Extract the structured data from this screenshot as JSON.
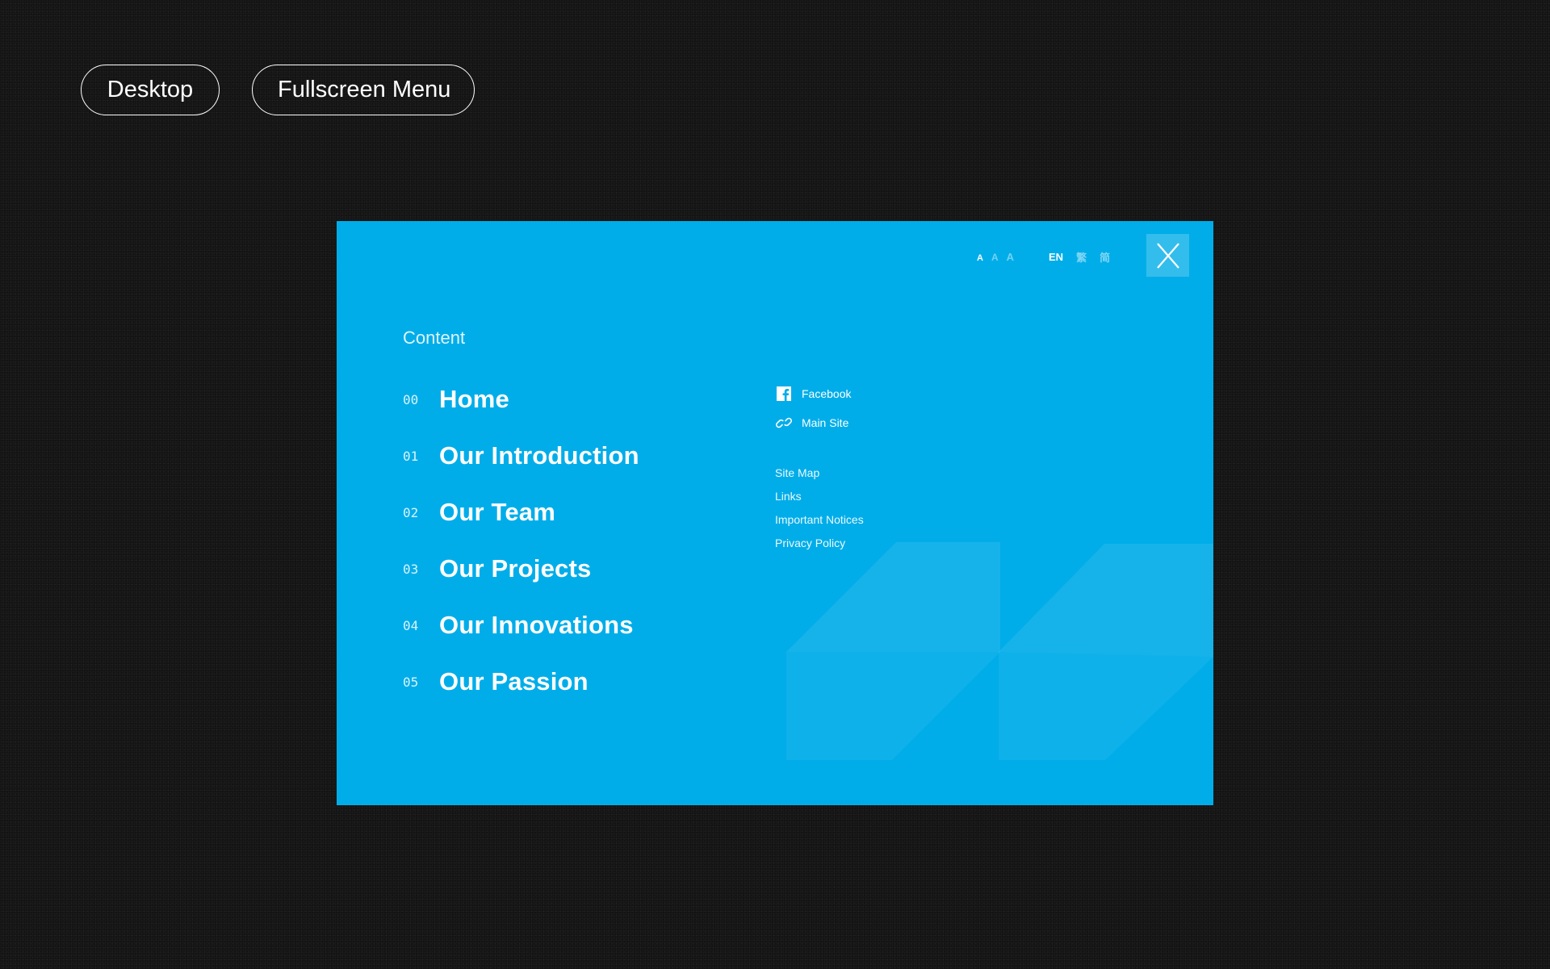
{
  "header": {
    "tags": [
      {
        "label": "Desktop"
      },
      {
        "label": "Fullscreen Menu"
      }
    ]
  },
  "menu_panel": {
    "background_color": "#00ade9",
    "font_sizes": [
      "A",
      "A",
      "A"
    ],
    "languages": [
      "EN",
      "繁",
      "简"
    ],
    "active_language": "EN",
    "close_icon": "close-icon",
    "section_label": "Content",
    "nav_items": [
      {
        "number": "00",
        "label": "Home"
      },
      {
        "number": "01",
        "label": "Our Introduction"
      },
      {
        "number": "02",
        "label": "Our Team"
      },
      {
        "number": "03",
        "label": "Our Projects"
      },
      {
        "number": "04",
        "label": "Our Innovations"
      },
      {
        "number": "05",
        "label": "Our Passion"
      }
    ],
    "social": [
      {
        "icon": "facebook-icon",
        "label": "Facebook"
      },
      {
        "icon": "link-icon",
        "label": "Main Site"
      }
    ],
    "footer_links": [
      "Site Map",
      "Links",
      "Important Notices",
      "Privacy Policy"
    ]
  }
}
